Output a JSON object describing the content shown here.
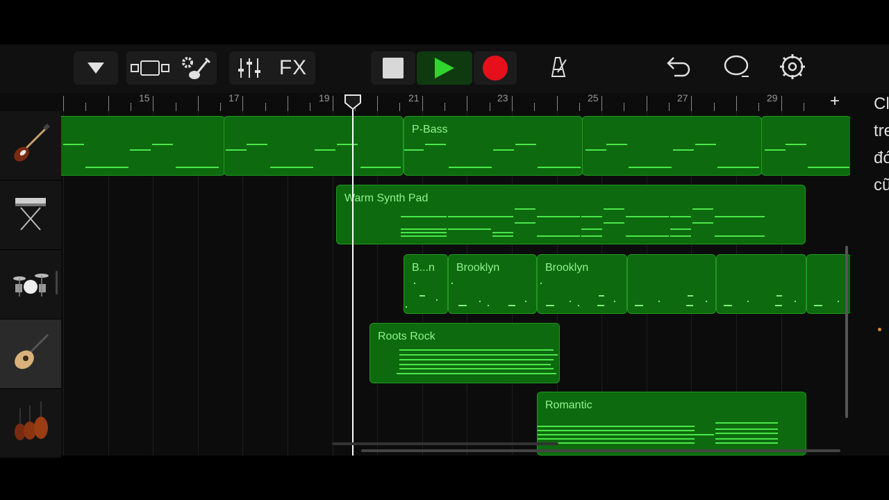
{
  "toolbar": {
    "fx_label": "FX",
    "icons": [
      "dropdown-triangle-icon",
      "tracks-view-icon",
      "instrument-settings-icon",
      "mixer-icon",
      "stop-icon",
      "play-icon",
      "record-icon",
      "metronome-icon",
      "undo-icon",
      "loop-icon",
      "settings-gear-icon"
    ]
  },
  "ruler": {
    "bars": [
      "15",
      "17",
      "19",
      "21",
      "23",
      "25",
      "27",
      "29"
    ],
    "add_label": "+"
  },
  "tracks": [
    {
      "instrument": "bass-guitar",
      "regions": [
        "P-Bass"
      ]
    },
    {
      "instrument": "synth-keyboard",
      "regions": [
        "Warm Synth Pad"
      ]
    },
    {
      "instrument": "drum-kit",
      "regions": [
        "B...n",
        "Brooklyn",
        "Brooklyn"
      ]
    },
    {
      "instrument": "acoustic-guitar",
      "regions": [
        "Roots Rock"
      ]
    },
    {
      "instrument": "strings",
      "regions": [
        "Romantic"
      ]
    }
  ],
  "side_text": [
    "Cl",
    "tre",
    "đó",
    "cũ"
  ],
  "colors": {
    "region_fill": "#0e6a0e",
    "note": "#4be84b",
    "record": "#e5101a",
    "play": "#2fd42f"
  }
}
